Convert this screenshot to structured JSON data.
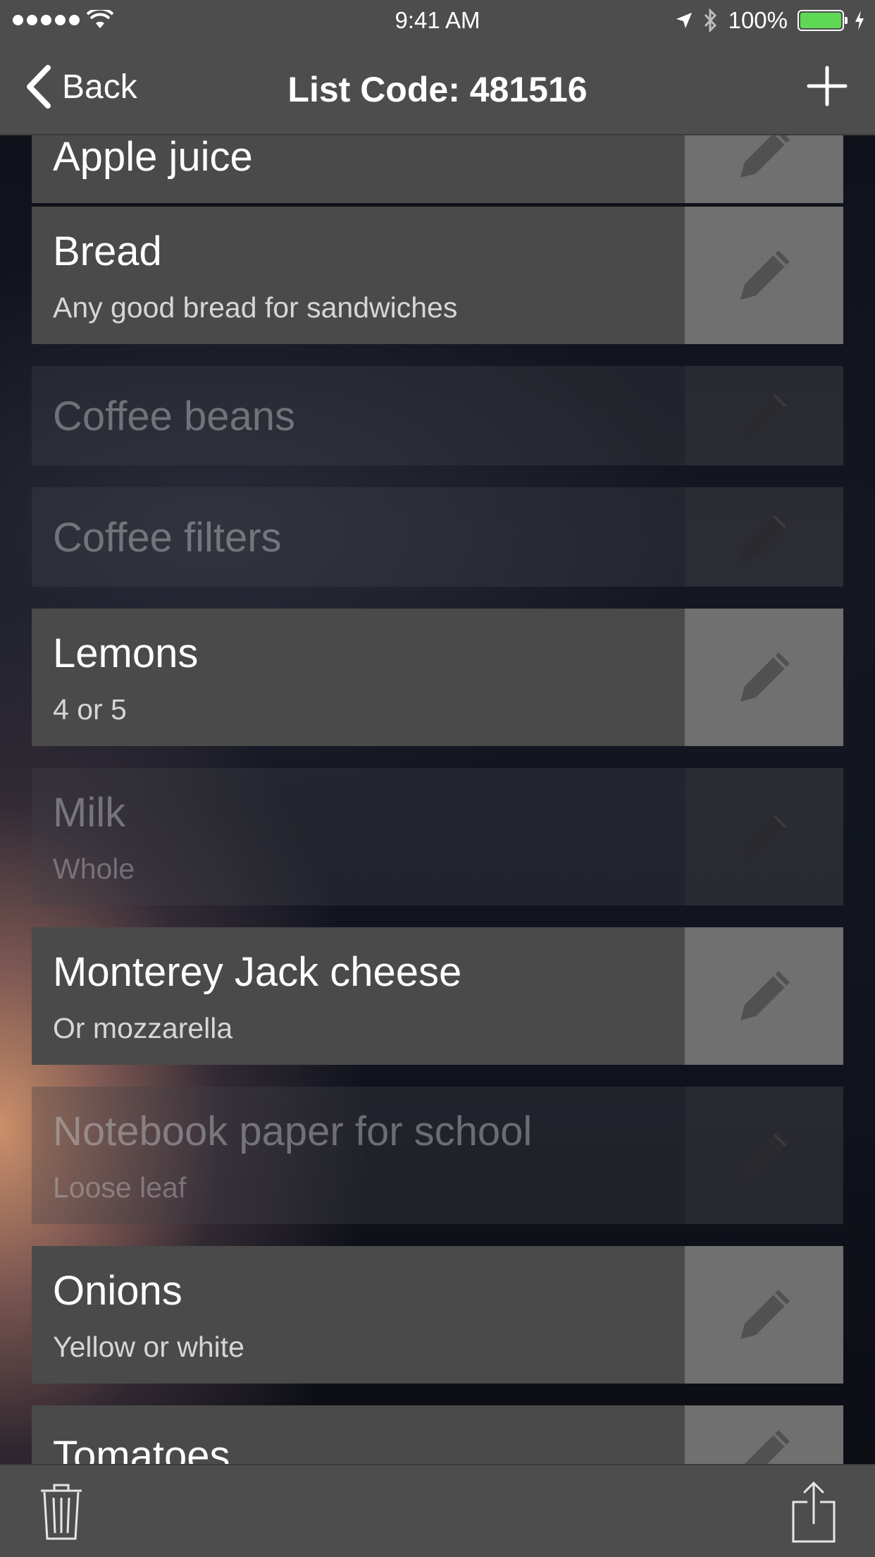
{
  "status": {
    "time": "9:41 AM",
    "battery": "100%",
    "signal_dots": 5,
    "battery_color": "#5fd856"
  },
  "nav": {
    "back_label": "Back",
    "title": "List Code: 481516",
    "add_icon": "plus-icon"
  },
  "items": [
    {
      "title": "Apple juice",
      "note": "",
      "checked": false
    },
    {
      "title": "Bread",
      "note": "Any good bread for sandwiches",
      "checked": false
    },
    {
      "title": "Coffee beans",
      "note": "",
      "checked": true
    },
    {
      "title": "Coffee filters",
      "note": "",
      "checked": true
    },
    {
      "title": "Lemons",
      "note": "4 or 5",
      "checked": false
    },
    {
      "title": "Milk",
      "note": "Whole",
      "checked": true
    },
    {
      "title": "Monterey Jack cheese",
      "note": "Or mozzarella",
      "checked": false
    },
    {
      "title": "Notebook paper for school",
      "note": "Loose leaf",
      "checked": true
    },
    {
      "title": "Onions",
      "note": "Yellow or white",
      "checked": false
    },
    {
      "title": "Tomatoes",
      "note": "",
      "checked": false
    }
  ],
  "toolbar": {
    "left_icon": "trash-icon",
    "right_icon": "share-icon"
  },
  "colors": {
    "bar_background": "#4d4d4d",
    "item_background": "#4a4a4a",
    "edit_background": "#707070"
  }
}
